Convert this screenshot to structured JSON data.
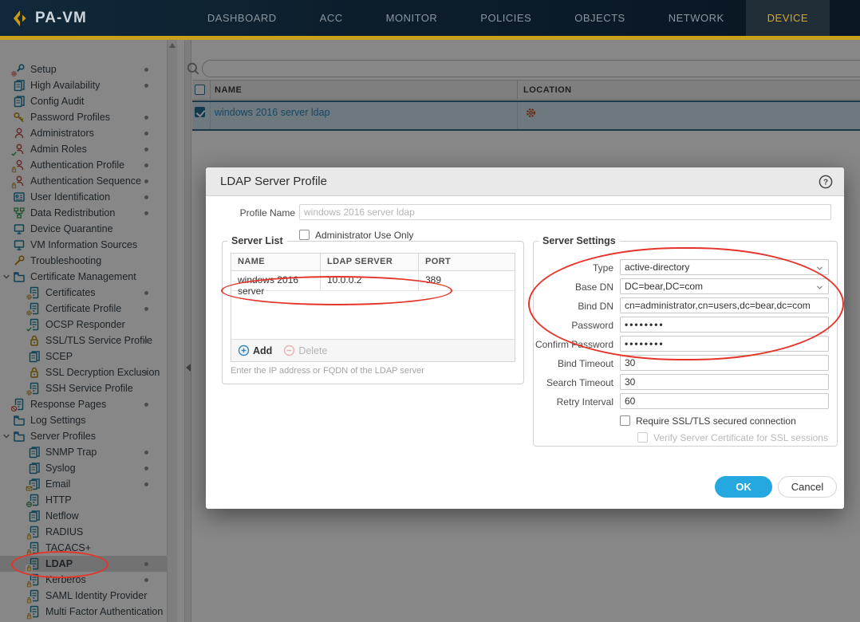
{
  "app": {
    "brand": "PA-VM"
  },
  "colors": {
    "accent_gold": "#C9A11B",
    "active_tab": "#D9A826",
    "ok_blue": "#25A8E0",
    "annotation_red": "#E5352B",
    "link_blue": "#2B85BA",
    "selected_row": "#D0E4F0"
  },
  "nav": {
    "tabs": [
      {
        "label": "DASHBOARD",
        "active": false
      },
      {
        "label": "ACC",
        "active": false
      },
      {
        "label": "MONITOR",
        "active": false
      },
      {
        "label": "POLICIES",
        "active": false
      },
      {
        "label": "OBJECTS",
        "active": false
      },
      {
        "label": "NETWORK",
        "active": false
      },
      {
        "label": "DEVICE",
        "active": true
      }
    ]
  },
  "sidebar": {
    "items": [
      {
        "label": "Setup",
        "dot": true
      },
      {
        "label": "High Availability",
        "dot": true
      },
      {
        "label": "Config Audit",
        "dot": false
      },
      {
        "label": "Password Profiles",
        "dot": true
      },
      {
        "label": "Administrators",
        "dot": true
      },
      {
        "label": "Admin Roles",
        "dot": true
      },
      {
        "label": "Authentication Profile",
        "dot": true
      },
      {
        "label": "Authentication Sequence",
        "dot": true
      },
      {
        "label": "User Identification",
        "dot": true
      },
      {
        "label": "Data Redistribution",
        "dot": true
      },
      {
        "label": "Device Quarantine",
        "dot": false
      },
      {
        "label": "VM Information Sources",
        "dot": false
      },
      {
        "label": "Troubleshooting",
        "dot": false
      },
      {
        "label": "Certificate Management",
        "dot": false,
        "expanded": true
      },
      {
        "label": "Certificates",
        "dot": true,
        "child": true
      },
      {
        "label": "Certificate Profile",
        "dot": true,
        "child": true
      },
      {
        "label": "OCSP Responder",
        "dot": false,
        "child": true
      },
      {
        "label": "SSL/TLS Service Profile",
        "dot": true,
        "child": true
      },
      {
        "label": "SCEP",
        "dot": false,
        "child": true
      },
      {
        "label": "SSL Decryption Exclusion",
        "dot": true,
        "child": true
      },
      {
        "label": "SSH Service Profile",
        "dot": false,
        "child": true
      },
      {
        "label": "Response Pages",
        "dot": true
      },
      {
        "label": "Log Settings",
        "dot": false
      },
      {
        "label": "Server Profiles",
        "dot": false,
        "expanded": true
      },
      {
        "label": "SNMP Trap",
        "dot": true,
        "child": true
      },
      {
        "label": "Syslog",
        "dot": true,
        "child": true
      },
      {
        "label": "Email",
        "dot": true,
        "child": true
      },
      {
        "label": "HTTP",
        "dot": false,
        "child": true
      },
      {
        "label": "Netflow",
        "dot": false,
        "child": true
      },
      {
        "label": "RADIUS",
        "dot": false,
        "child": true
      },
      {
        "label": "TACACS+",
        "dot": false,
        "child": true
      },
      {
        "label": "LDAP",
        "dot": true,
        "child": true,
        "selected": true
      },
      {
        "label": "Kerberos",
        "dot": true,
        "child": true
      },
      {
        "label": "SAML Identity Provider",
        "dot": false,
        "child": true
      },
      {
        "label": "Multi Factor Authentication",
        "dot": false,
        "child": true
      }
    ]
  },
  "content": {
    "search_value": "",
    "table": {
      "columns": {
        "name": "NAME",
        "location": "LOCATION"
      },
      "rows": [
        {
          "name": "windows 2016 server ldap",
          "location": "",
          "selected": true
        }
      ]
    }
  },
  "dialog": {
    "title": "LDAP Server Profile",
    "profile_name_label": "Profile Name",
    "profile_name_value": "windows 2016 server ldap",
    "admin_only_label": "Administrator Use Only",
    "admin_only_checked": false,
    "server_list": {
      "legend": "Server List",
      "columns": {
        "name": "NAME",
        "server": "LDAP SERVER",
        "port": "PORT"
      },
      "rows": [
        {
          "name": "windows 2016 server",
          "server": "10.0.0.2",
          "port": "389"
        }
      ],
      "add_label": "Add",
      "delete_label": "Delete",
      "hint": "Enter the IP address or FQDN of the LDAP server"
    },
    "server_settings": {
      "legend": "Server Settings",
      "type_label": "Type",
      "type_value": "active-directory",
      "base_dn_label": "Base DN",
      "base_dn_value": "DC=bear,DC=com",
      "bind_dn_label": "Bind DN",
      "bind_dn_value": "cn=administrator,cn=users,dc=bear,dc=com",
      "password_label": "Password",
      "password_value": "••••••••",
      "confirm_password_label": "Confirm Password",
      "confirm_password_value": "••••••••",
      "bind_timeout_label": "Bind Timeout",
      "bind_timeout_value": "30",
      "search_timeout_label": "Search Timeout",
      "search_timeout_value": "30",
      "retry_interval_label": "Retry Interval",
      "retry_interval_value": "60",
      "require_ssl_label": "Require SSL/TLS secured connection",
      "require_ssl_checked": false,
      "verify_cert_label": "Verify Server Certificate for SSL sessions",
      "verify_cert_checked": false,
      "verify_cert_disabled": true
    },
    "ok_label": "OK",
    "cancel_label": "Cancel"
  }
}
